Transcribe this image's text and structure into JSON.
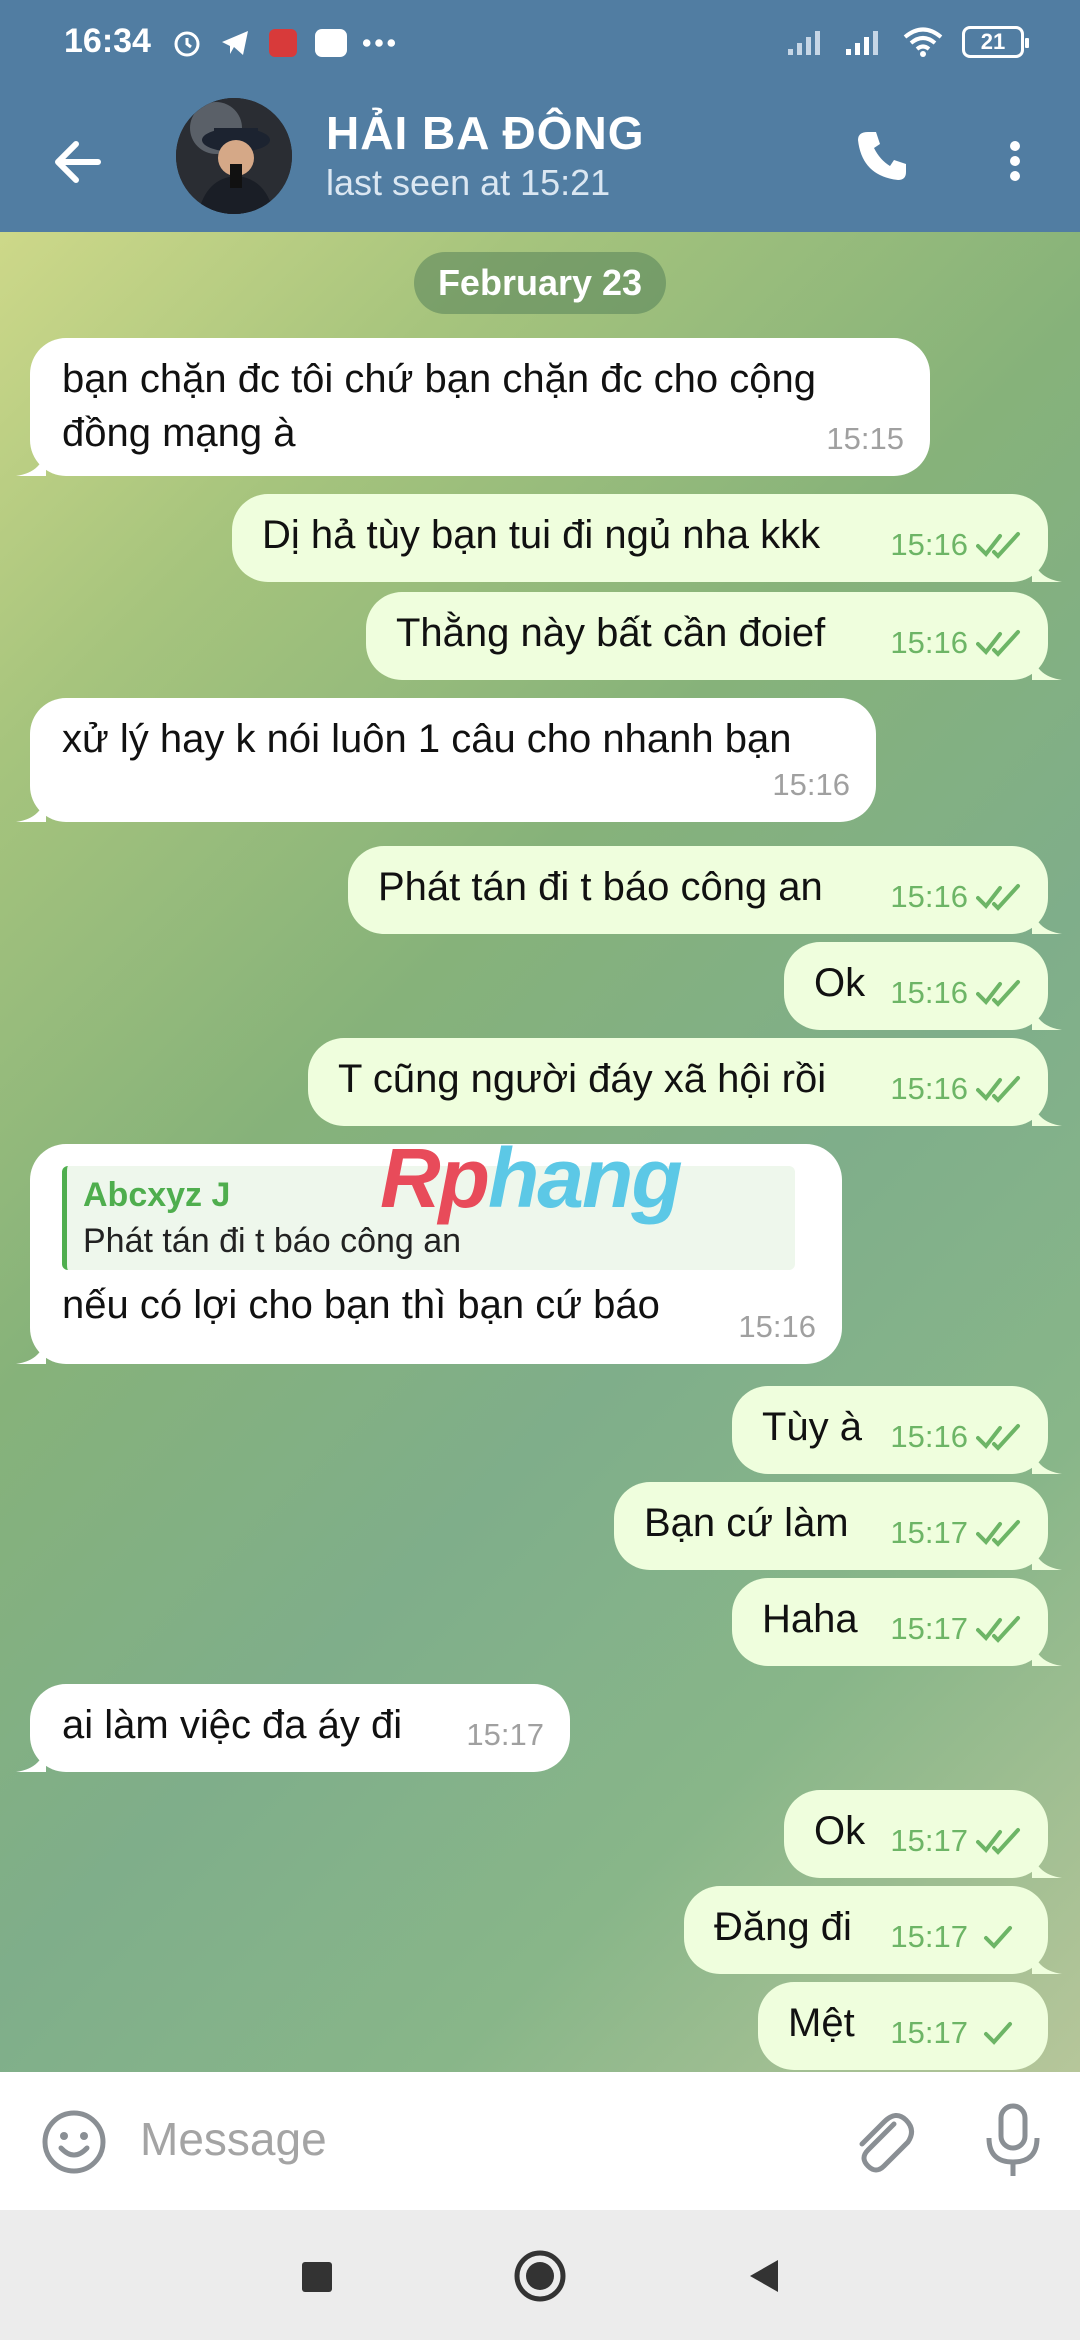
{
  "status": {
    "time": "16:34",
    "battery": "21",
    "app_icon_label": "Zalo"
  },
  "header": {
    "title": "HẢI BA ĐÔNG",
    "subtitle": "last seen at 15:21"
  },
  "chat": {
    "date": "February 23",
    "watermark": {
      "part1": "Rp",
      "part2": "hang"
    },
    "messages": [
      {
        "dir": "in",
        "text": "bạn chặn đc tôi chứ bạn chặn đc cho cộng đồng mạng à",
        "time": "15:15"
      },
      {
        "dir": "out",
        "text": "Dị hả tùy bạn tui đi ngủ nha kkk",
        "time": "15:16",
        "status": "read"
      },
      {
        "dir": "out",
        "text": "Thằng này bất cần đoief",
        "time": "15:16",
        "status": "read"
      },
      {
        "dir": "in",
        "text": "xử lý hay k nói luôn 1 câu cho nhanh bạn",
        "time": "15:16"
      },
      {
        "dir": "out",
        "text": "Phát tán đi t báo công an",
        "time": "15:16",
        "status": "read"
      },
      {
        "dir": "out",
        "text": "Ok",
        "time": "15:16",
        "status": "read"
      },
      {
        "dir": "out",
        "text": "T cũng người đáy xã hội rồi",
        "time": "15:16",
        "status": "read"
      },
      {
        "dir": "in",
        "reply_name": "Abcxyz J",
        "reply_text": "Phát tán đi t báo công an",
        "text": "nếu có lợi cho bạn thì bạn cứ báo",
        "time": "15:16"
      },
      {
        "dir": "out",
        "text": "Tùy à",
        "time": "15:16",
        "status": "read"
      },
      {
        "dir": "out",
        "text": "Bạn cứ làm",
        "time": "15:17",
        "status": "read"
      },
      {
        "dir": "out",
        "text": "Haha",
        "time": "15:17",
        "status": "read"
      },
      {
        "dir": "in",
        "text": "ai làm việc đa áy đi",
        "time": "15:17"
      },
      {
        "dir": "out",
        "text": "Ok",
        "time": "15:17",
        "status": "read"
      },
      {
        "dir": "out",
        "text": "Đăng đi",
        "time": "15:17",
        "status": "sent"
      },
      {
        "dir": "out",
        "text": "Mệt",
        "time": "15:17",
        "status": "sent"
      }
    ]
  },
  "composer": {
    "placeholder": "Message"
  },
  "colors": {
    "header": "#517da2",
    "outgoing": "#effedd",
    "incoming": "#ffffff",
    "check": "#6db566"
  }
}
